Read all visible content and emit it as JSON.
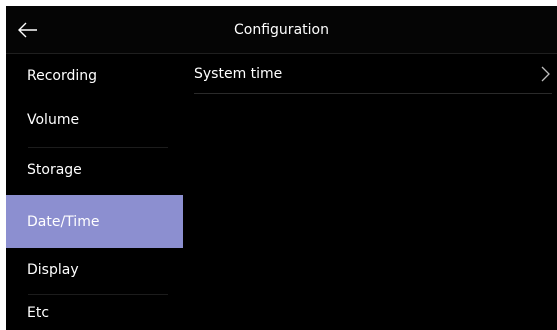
{
  "header": {
    "title": "Configuration",
    "back_icon": "arrow-left-icon"
  },
  "sidebar": {
    "active_color": "#8c8fd0",
    "items": [
      {
        "label": "Recording"
      },
      {
        "label": "Volume"
      },
      {
        "label": "Storage"
      },
      {
        "label": "Date/Time",
        "active": true
      },
      {
        "label": "Display"
      },
      {
        "label": "Etc"
      }
    ]
  },
  "content": {
    "rows": [
      {
        "label": "System time",
        "icon": "chevron-right-icon"
      }
    ]
  }
}
